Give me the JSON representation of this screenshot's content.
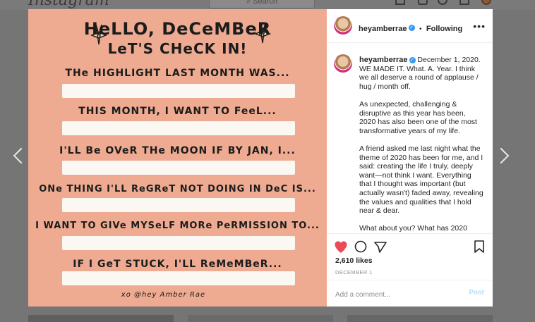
{
  "app": {
    "logo_text": "Instagram",
    "search_placeholder": "Search"
  },
  "post": {
    "image": {
      "title_line1": "HeLLO, DeCeMBeR",
      "title_line2": "LeT'S CHeCK IN!",
      "prompts": [
        "THe HIGHLIGHT LAST MONTH WAS...",
        "THIS MONTH, I WANT TO FeeL...",
        "I'LL Be OVeR THe MOON IF BY JAN, I...",
        "ONe THING I'LL ReGReT NOT DOING IN DeC IS...",
        "I WANT TO GIVe MYSeLF MORe PeRMISSION TO...",
        "IF  I  GeT  STUCK, I'LL ReMeMBeR..."
      ],
      "signature": "xo @hey Amber Rae",
      "background_color": "#eeab91"
    },
    "header": {
      "username": "heyamberrae",
      "separator": "•",
      "follow_status": "Following",
      "more_label": "•••"
    },
    "caption": {
      "username": "heyamberrae",
      "paragraphs": [
        "December 1, 2020. WE MADE IT. What. A. Year. I think we all deserve a round of applause / hug / month off.",
        "As unexpected, challenging & disruptive as this year has been, 2020 has also been one of the most transformative years of my life.",
        "A friend asked me last night what the theme of 2020 has been for me, and I said: creating the life I truly, deeply want—not think I want. Everything that I thought was important (but actually wasn't) faded away, revealing the values and qualities that I hold near & dear.",
        "What about you? What has 2020"
      ]
    },
    "likes": "2,610 likes",
    "date": "DECEMBER 1",
    "comment": {
      "placeholder": "Add a comment...",
      "post_label": "Post"
    },
    "colors": {
      "like_red": "#ed4956",
      "verified_blue": "#3897f0",
      "post_disabled": "#b2dffc"
    }
  }
}
